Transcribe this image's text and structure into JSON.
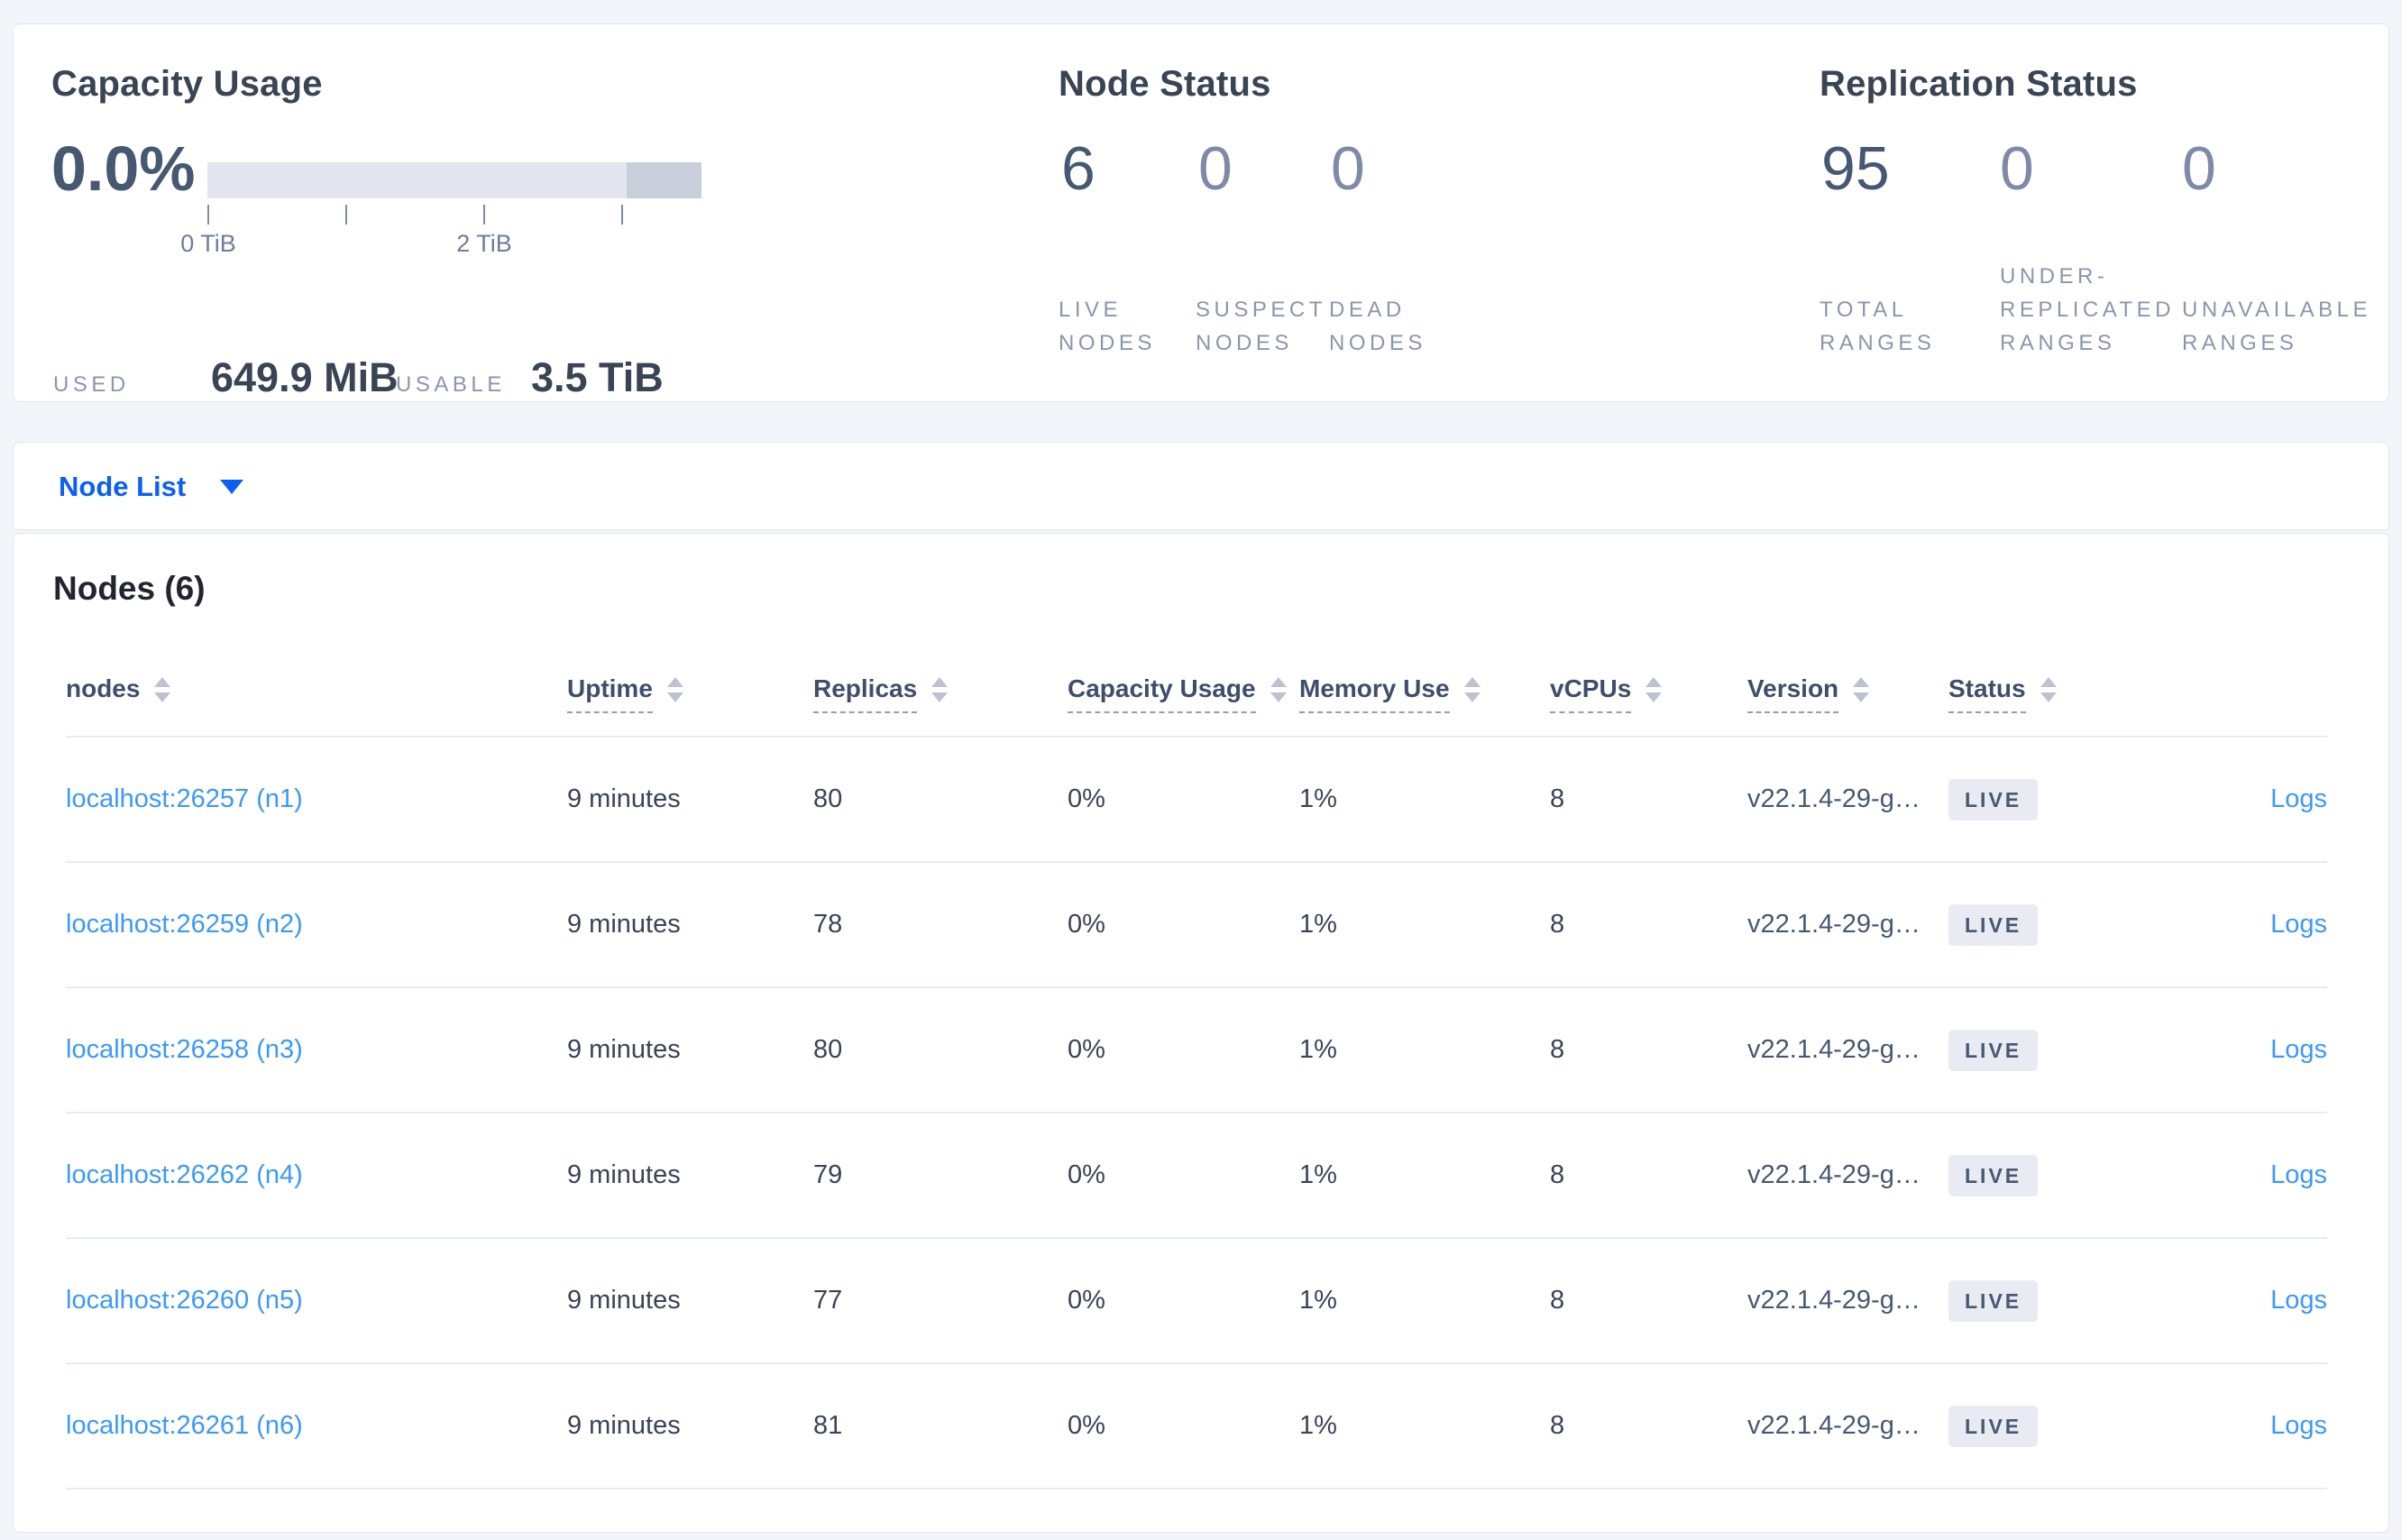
{
  "summary": {
    "capacity": {
      "title": "Capacity Usage",
      "percent": "0.0%",
      "tick_labels": [
        "0 TiB",
        "2 TiB"
      ],
      "used_label": "USED",
      "used_value": "649.9 MiB",
      "usable_label": "USABLE",
      "usable_value": "3.5 TiB"
    },
    "node_status": {
      "title": "Node Status",
      "stats": [
        {
          "value": "6",
          "label_lines": [
            "LIVE",
            "NODES"
          ]
        },
        {
          "value": "0",
          "label_lines": [
            "SUSPECT",
            "NODES"
          ]
        },
        {
          "value": "0",
          "label_lines": [
            "DEAD",
            "NODES"
          ]
        }
      ]
    },
    "replication_status": {
      "title": "Replication Status",
      "stats": [
        {
          "value": "95",
          "label_lines": [
            "TOTAL",
            "RANGES"
          ]
        },
        {
          "value": "0",
          "label_lines": [
            "UNDER-",
            "REPLICATED",
            "RANGES"
          ]
        },
        {
          "value": "0",
          "label_lines": [
            "UNAVAILABLE",
            "RANGES"
          ]
        }
      ]
    }
  },
  "nav": {
    "view_label": "Node List"
  },
  "table": {
    "title": "Nodes (6)",
    "columns": [
      {
        "label": "nodes"
      },
      {
        "label": "Uptime"
      },
      {
        "label": "Replicas"
      },
      {
        "label": "Capacity Usage"
      },
      {
        "label": "Memory Use"
      },
      {
        "label": "vCPUs"
      },
      {
        "label": "Version"
      },
      {
        "label": "Status"
      }
    ],
    "rows": [
      {
        "node": "localhost:26257 (n1)",
        "uptime": "9 minutes",
        "replicas": "80",
        "capacity": "0%",
        "memory": "1%",
        "vcpus": "8",
        "version": "v22.1.4-29-g…",
        "status": "LIVE",
        "logs": "Logs"
      },
      {
        "node": "localhost:26259 (n2)",
        "uptime": "9 minutes",
        "replicas": "78",
        "capacity": "0%",
        "memory": "1%",
        "vcpus": "8",
        "version": "v22.1.4-29-g…",
        "status": "LIVE",
        "logs": "Logs"
      },
      {
        "node": "localhost:26258 (n3)",
        "uptime": "9 minutes",
        "replicas": "80",
        "capacity": "0%",
        "memory": "1%",
        "vcpus": "8",
        "version": "v22.1.4-29-g…",
        "status": "LIVE",
        "logs": "Logs"
      },
      {
        "node": "localhost:26262 (n4)",
        "uptime": "9 minutes",
        "replicas": "79",
        "capacity": "0%",
        "memory": "1%",
        "vcpus": "8",
        "version": "v22.1.4-29-g…",
        "status": "LIVE",
        "logs": "Logs"
      },
      {
        "node": "localhost:26260 (n5)",
        "uptime": "9 minutes",
        "replicas": "77",
        "capacity": "0%",
        "memory": "1%",
        "vcpus": "8",
        "version": "v22.1.4-29-g…",
        "status": "LIVE",
        "logs": "Logs"
      },
      {
        "node": "localhost:26261 (n6)",
        "uptime": "9 minutes",
        "replicas": "81",
        "capacity": "0%",
        "memory": "1%",
        "vcpus": "8",
        "version": "v22.1.4-29-g…",
        "status": "LIVE",
        "logs": "Logs"
      }
    ]
  },
  "colors": {
    "page_bg": "#f2f5f9",
    "card_border": "#e2e7ef",
    "title_text": "#394455",
    "stat_primary": "#475872",
    "stat_zero": "#7e8ba8",
    "muted_caps_label": "#8a96ad",
    "bar_light": "#e3e6ee",
    "bar_dark": "#c9cedb",
    "nav_link_blue": "#0b5ff5",
    "table_link_blue": "#3b99fc",
    "badge_bg": "#e8ecf2",
    "row_border": "#e7ecf3"
  }
}
